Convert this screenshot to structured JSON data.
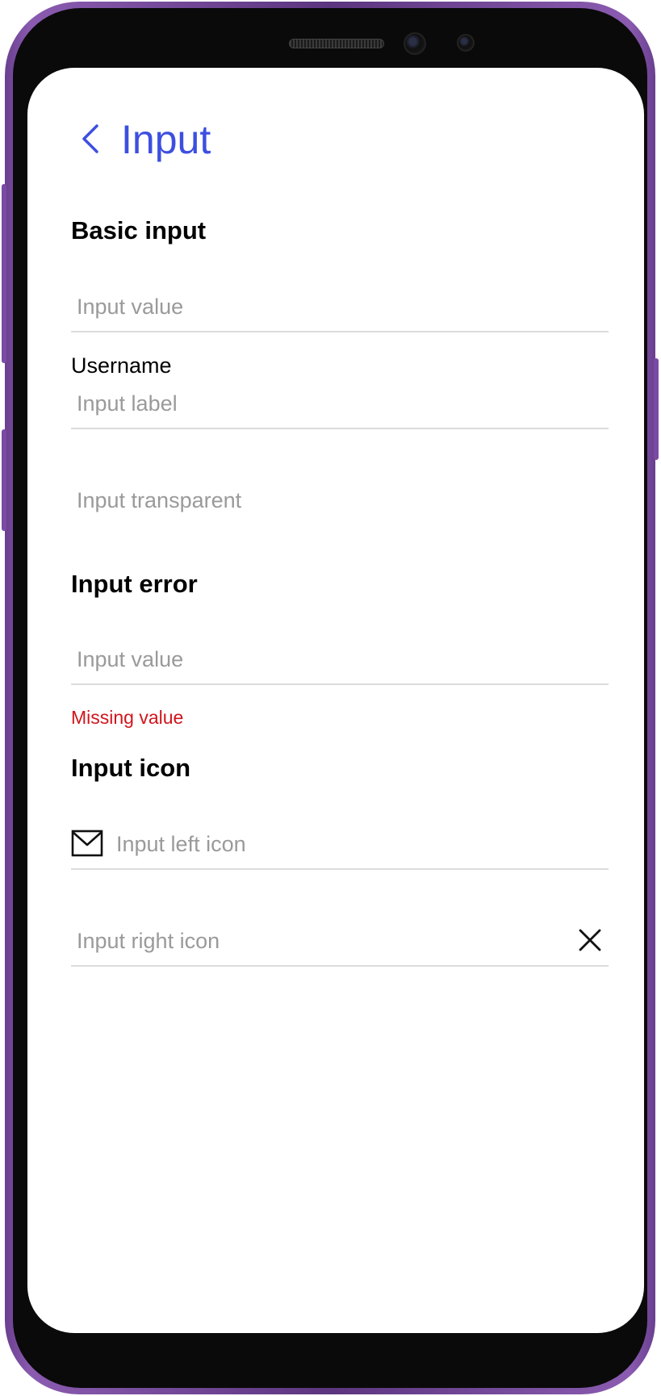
{
  "header": {
    "title": "Input",
    "back_icon": "chevron-left-icon"
  },
  "colors": {
    "accent": "#3d4fe0",
    "error": "#d0151c",
    "placeholder": "#9a9a9a",
    "divider": "#dcdcdc",
    "frame": "#7b4aa3"
  },
  "basic": {
    "title": "Basic input",
    "value_placeholder": "Input value",
    "label_text": "Username",
    "label_placeholder": "Input label",
    "transparent_placeholder": "Input transparent"
  },
  "error_section": {
    "title": "Input error",
    "placeholder": "Input value",
    "message": "Missing value"
  },
  "icon_section": {
    "title": "Input icon",
    "left_placeholder": "Input left icon",
    "left_icon": "mail-icon",
    "right_placeholder": "Input right icon",
    "right_icon": "close-icon"
  }
}
